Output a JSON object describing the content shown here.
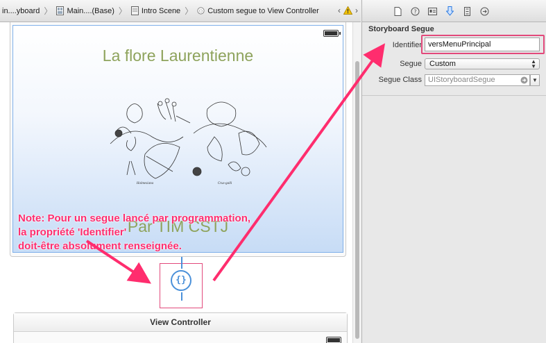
{
  "jumpbar": {
    "crumbs": [
      "in....yboard",
      "Main....(Base)",
      "Intro Scene",
      "Custom segue to View Controller"
    ],
    "warning_icon": "warning-icon"
  },
  "scene": {
    "title": "La flore Laurentienne",
    "author": "Par TIM CSTJ",
    "plate_caption_left": "Holmesiana",
    "plate_caption_right": "Crus-galli"
  },
  "note": {
    "lines": [
      "Note: Pour un segue lancé par programmation,",
      "la propriété 'Identifier'",
      "doit-être absolument renseignée."
    ]
  },
  "segue_node": {
    "glyph": "{}"
  },
  "view_controller": {
    "title": "View Controller"
  },
  "inspector": {
    "tabs": [
      "file-icon",
      "help-icon",
      "identity-icon",
      "attributes-icon",
      "size-icon",
      "connections-icon"
    ],
    "section_title": "Storyboard Segue",
    "identifier_label": "Identifier",
    "identifier_value": "versMenuPrincipal",
    "segue_label": "Segue",
    "segue_value": "Custom",
    "segue_class_label": "Segue Class",
    "segue_class_value": "UIStoryboardSegue"
  },
  "colors": {
    "annotation": "#ff2d6e",
    "segue": "#4a90d9",
    "title_green": "#8ea35c"
  }
}
